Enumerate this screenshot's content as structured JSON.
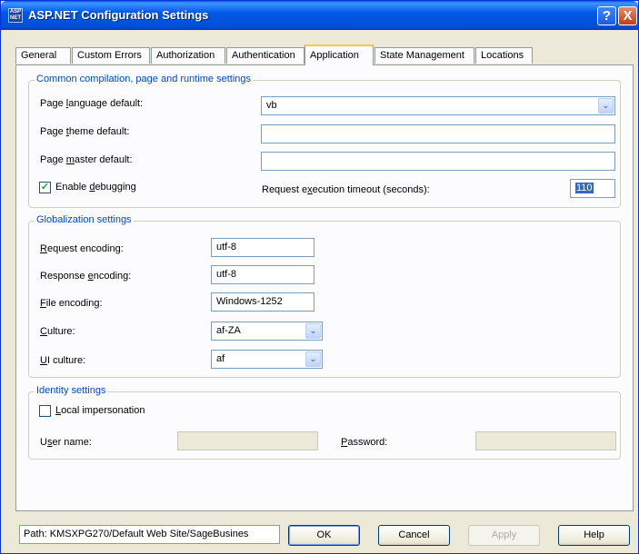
{
  "window": {
    "title": "ASP.NET Configuration Settings",
    "icon_text": "ASP NET",
    "help_glyph": "?",
    "close_glyph": "X"
  },
  "tabs": [
    {
      "label": "General"
    },
    {
      "label": "Custom Errors"
    },
    {
      "label": "Authorization"
    },
    {
      "label": "Authentication"
    },
    {
      "label": "Application",
      "active": true
    },
    {
      "label": "State Management"
    },
    {
      "label": "Locations"
    }
  ],
  "compilation": {
    "legend": "Common compilation, page and runtime settings",
    "page_language": {
      "label_pre": "Page ",
      "label_key": "l",
      "label_post": "anguage default:",
      "value": "vb"
    },
    "page_theme": {
      "label_pre": "Page ",
      "label_key": "t",
      "label_post": "heme default:",
      "value": ""
    },
    "page_master": {
      "label_pre": "Page ",
      "label_key": "m",
      "label_post": "aster default:",
      "value": ""
    },
    "debugging": {
      "label_pre": "Enable ",
      "label_key": "d",
      "label_post": "ebugging",
      "checked": true,
      "check_glyph": "✓"
    },
    "timeout": {
      "label_pre": "Request e",
      "label_key": "x",
      "label_post": "ecution timeout (seconds):",
      "value": "110"
    }
  },
  "globalization": {
    "legend": "Globalization settings",
    "request_encoding": {
      "label_key": "R",
      "label_post": "equest encoding:",
      "value": "utf-8"
    },
    "response_encoding": {
      "label_pre": "Response ",
      "label_key": "e",
      "label_post": "ncoding:",
      "value": "utf-8"
    },
    "file_encoding": {
      "label_key": "F",
      "label_post": "ile encoding:",
      "value": "Windows-1252"
    },
    "culture": {
      "label_key": "C",
      "label_post": "ulture:",
      "value": "af-ZA"
    },
    "ui_culture": {
      "label_key": "U",
      "label_post": "I culture:",
      "value": "af"
    }
  },
  "identity": {
    "legend": "Identity settings",
    "impersonation": {
      "label_key": "L",
      "label_post": "ocal impersonation",
      "checked": false
    },
    "user_name": {
      "label_pre": "U",
      "label_key": "s",
      "label_post": "er name:",
      "value": ""
    },
    "password": {
      "label_key": "P",
      "label_post": "assword:",
      "value": ""
    }
  },
  "footer": {
    "path": "Path: KMSXPG270/Default Web Site/SageBusines",
    "ok": "OK",
    "cancel": "Cancel",
    "apply": "Apply",
    "help": "Help"
  },
  "combo_arrow_glyph": "⌄"
}
